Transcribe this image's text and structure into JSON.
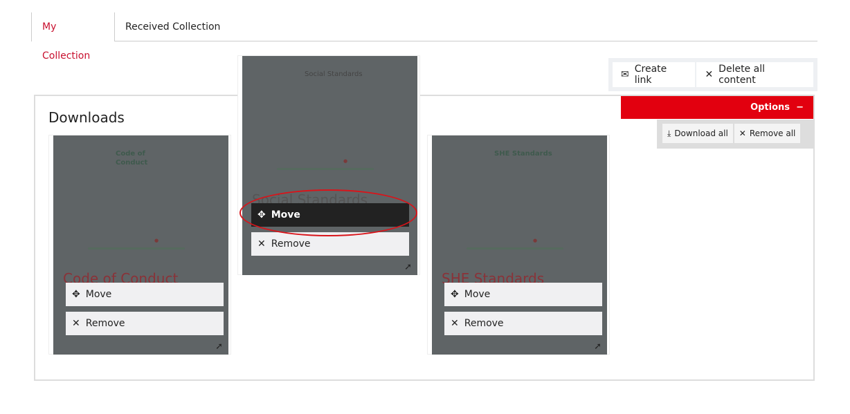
{
  "tabs": [
    {
      "label": "My Collection",
      "active": true
    },
    {
      "label": "Received Collection",
      "active": false
    }
  ],
  "actions": {
    "create_link": "Create link",
    "delete_all": "Delete all content"
  },
  "options": {
    "label": "Options",
    "toggle": "−",
    "download_all": "Download all",
    "remove_all": "Remove all"
  },
  "panel": {
    "title": "Downloads"
  },
  "cards": [
    {
      "cover_title": "Code of Conduct",
      "title": "Code of Conduct",
      "move": "Move",
      "remove": "Remove"
    },
    {
      "cover_title": "Social Standards",
      "title": "Social Standards",
      "move": "Move",
      "remove": "Remove"
    },
    {
      "cover_title": "SHE Standards",
      "title": "SHE Standards",
      "move": "Move",
      "remove": "Remove"
    }
  ],
  "colors": {
    "accent": "#e2000f",
    "tab_active": "#c8102e",
    "highlight": "#d9141a"
  }
}
